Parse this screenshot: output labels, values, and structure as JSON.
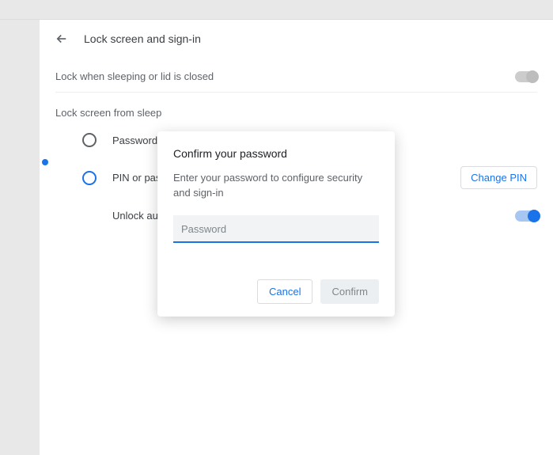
{
  "header": {
    "title": "Lock screen and sign-in"
  },
  "settings": {
    "lock_sleep_label": "Lock when sleeping or lid is closed",
    "lock_sleep_enabled": false,
    "from_sleep_title": "Lock screen from sleep",
    "options": [
      {
        "label": "Password",
        "selected": false
      },
      {
        "label": "PIN or password",
        "selected": true
      }
    ],
    "change_pin_label": "Change PIN",
    "unlock_auto_label": "Unlock automatically",
    "unlock_auto_enabled": true
  },
  "modal": {
    "title": "Confirm your password",
    "text": "Enter your password to configure security and sign-in",
    "placeholder": "Password",
    "value": "",
    "cancel_label": "Cancel",
    "confirm_label": "Confirm"
  }
}
